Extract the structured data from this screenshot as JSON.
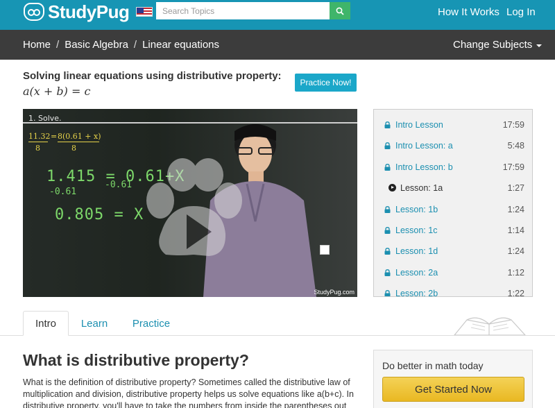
{
  "header": {
    "logo_text": "StudyPug",
    "search_placeholder": "Search Topics",
    "nav": {
      "how_it_works": "How It Works",
      "login": "Log In"
    },
    "brand_color": "#1795b4"
  },
  "breadcrumb": {
    "items": [
      "Home",
      "Basic Algebra",
      "Linear equations"
    ],
    "separator": "/",
    "change_subjects": "Change Subjects"
  },
  "page": {
    "title_text": "Solving linear equations using distributive property: ",
    "title_math": "a(x + b) = c",
    "practice_button": "Practice Now!"
  },
  "video": {
    "board_title": "1. Solve.",
    "eq1_left": "11.32",
    "eq1_right": "8(0.61 + x)",
    "eq1_den_left": "8",
    "eq1_den_right": "8",
    "line1": "1.415 = 0.61+X",
    "line1_sub_left": "-0.61",
    "line1_sub_right": "-0.61",
    "line2": "0.805 = X",
    "watermark": "StudyPug.com"
  },
  "lessons": [
    {
      "name": "Intro Lesson",
      "duration": "17:59",
      "locked": true,
      "active": false
    },
    {
      "name": "Intro Lesson: a",
      "duration": "5:48",
      "locked": true,
      "active": false
    },
    {
      "name": "Intro Lesson: b",
      "duration": "17:59",
      "locked": true,
      "active": false
    },
    {
      "name": "Lesson: 1a",
      "duration": "1:27",
      "locked": false,
      "active": true
    },
    {
      "name": "Lesson: 1b",
      "duration": "1:24",
      "locked": true,
      "active": false
    },
    {
      "name": "Lesson: 1c",
      "duration": "1:14",
      "locked": true,
      "active": false
    },
    {
      "name": "Lesson: 1d",
      "duration": "1:24",
      "locked": true,
      "active": false
    },
    {
      "name": "Lesson: 2a",
      "duration": "1:12",
      "locked": true,
      "active": false
    },
    {
      "name": "Lesson: 2b",
      "duration": "1:22",
      "locked": true,
      "active": false
    }
  ],
  "tabs": [
    "Intro",
    "Learn",
    "Practice"
  ],
  "content": {
    "heading": "What is distributive property?",
    "paragraph": "What is the definition of distributive property? Sometimes called the distributive law of multiplication and division, distributive property helps us solve equations like a(b+c). In distributive property, you'll have to take the numbers from inside the parentheses out"
  },
  "cta": {
    "title": "Do better in math today",
    "button": "Get Started Now",
    "button_color": "#f0c93f"
  }
}
